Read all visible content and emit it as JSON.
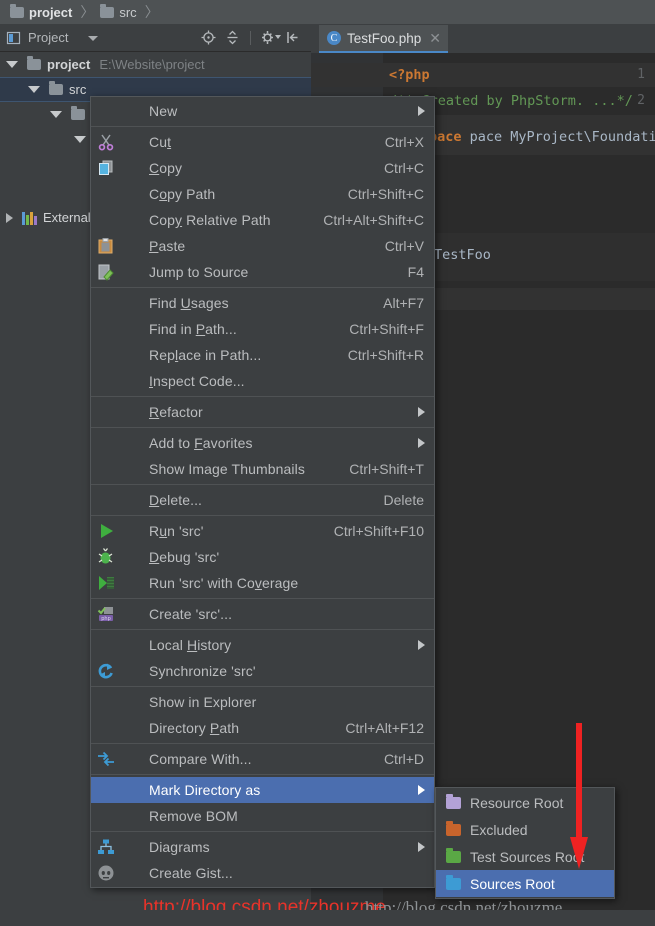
{
  "breadcrumb": {
    "items": [
      {
        "label": "project",
        "icon": "folder-icon",
        "bold": true
      },
      {
        "label": "src",
        "icon": "folder-icon",
        "bold": false
      }
    ],
    "separator": "〉"
  },
  "tool_window": {
    "title": "Project",
    "dropdown_icon": "chevron-down-icon",
    "window_icon": "project-view-icon",
    "actions": [
      {
        "name": "scroll-from-source-icon",
        "tip": "Select Opened File"
      },
      {
        "name": "collapse-all-icon",
        "tip": "Collapse All"
      },
      {
        "name": "gear-icon",
        "tip": "Settings"
      },
      {
        "name": "hide-icon",
        "tip": "Hide"
      }
    ]
  },
  "tree": {
    "rows": [
      {
        "name": "project",
        "path": "E:\\Website\\project",
        "expanded": true,
        "depth": 0,
        "icon": "folder-icon",
        "selected": false
      },
      {
        "name": "src",
        "path": "",
        "expanded": true,
        "depth": 1,
        "icon": "folder-icon",
        "selected": true
      },
      {
        "name": "",
        "path": "",
        "expanded": true,
        "depth": 2,
        "icon": "folder-icon",
        "selected": false
      },
      {
        "name": "",
        "path": "",
        "expanded": true,
        "depth": 3,
        "icon": "folder-icon",
        "selected": false
      },
      {
        "name": "External Libraries",
        "path": "",
        "expanded": false,
        "depth": 0,
        "icon": "libraries-icon",
        "selected": false
      }
    ]
  },
  "editor": {
    "tab": {
      "label": "TestFoo.php",
      "icon_letter": "C",
      "close_icon": "close-icon"
    },
    "lines": [
      {
        "number": "1",
        "text": "<?php",
        "kind": "keyword"
      },
      {
        "number": "2",
        "text": "/** Created by PhpStorm. ...*/",
        "kind": "comment"
      }
    ],
    "namespace_fragment": "pace MyProject\\Foundation",
    "namespace_keyword": "pace",
    "class_name_fragment": "TestFoo"
  },
  "context_menu": {
    "groups": [
      {
        "items": [
          {
            "label": "New",
            "mnemonic": "",
            "shortcut": "",
            "submenu": true,
            "icon": "",
            "highlighted": false
          }
        ]
      },
      {
        "items": [
          {
            "label": "Cut",
            "mnemonic": "t",
            "shortcut": "Ctrl+X",
            "submenu": false,
            "icon": "cut-icon",
            "highlighted": false
          },
          {
            "label": "Copy",
            "mnemonic": "C",
            "shortcut": "Ctrl+C",
            "submenu": false,
            "icon": "copy-icon",
            "highlighted": false
          },
          {
            "label": "Copy Path",
            "mnemonic": "o",
            "shortcut": "Ctrl+Shift+C",
            "submenu": false,
            "icon": "",
            "highlighted": false
          },
          {
            "label": "Copy Relative Path",
            "mnemonic": "y",
            "shortcut": "Ctrl+Alt+Shift+C",
            "submenu": false,
            "icon": "",
            "highlighted": false
          },
          {
            "label": "Paste",
            "mnemonic": "P",
            "shortcut": "Ctrl+V",
            "submenu": false,
            "icon": "paste-icon",
            "highlighted": false
          },
          {
            "label": "Jump to Source",
            "mnemonic": "",
            "shortcut": "F4",
            "submenu": false,
            "icon": "jump-to-source-icon",
            "highlighted": false
          }
        ]
      },
      {
        "items": [
          {
            "label": "Find Usages",
            "mnemonic": "U",
            "shortcut": "Alt+F7",
            "submenu": false,
            "icon": "",
            "highlighted": false
          },
          {
            "label": "Find in Path...",
            "mnemonic": "P",
            "shortcut": "Ctrl+Shift+F",
            "submenu": false,
            "icon": "",
            "highlighted": false
          },
          {
            "label": "Replace in Path...",
            "mnemonic": "l",
            "shortcut": "Ctrl+Shift+R",
            "submenu": false,
            "icon": "",
            "highlighted": false
          },
          {
            "label": "Inspect Code...",
            "mnemonic": "I",
            "shortcut": "",
            "submenu": false,
            "icon": "",
            "highlighted": false
          }
        ]
      },
      {
        "items": [
          {
            "label": "Refactor",
            "mnemonic": "R",
            "shortcut": "",
            "submenu": true,
            "icon": "",
            "highlighted": false
          }
        ]
      },
      {
        "items": [
          {
            "label": "Add to Favorites",
            "mnemonic": "F",
            "shortcut": "",
            "submenu": true,
            "icon": "",
            "highlighted": false
          },
          {
            "label": "Show Image Thumbnails",
            "mnemonic": "",
            "shortcut": "Ctrl+Shift+T",
            "submenu": false,
            "icon": "",
            "highlighted": false
          }
        ]
      },
      {
        "items": [
          {
            "label": "Delete...",
            "mnemonic": "D",
            "shortcut": "Delete",
            "submenu": false,
            "icon": "",
            "highlighted": false
          }
        ]
      },
      {
        "items": [
          {
            "label": "Run 'src'",
            "mnemonic": "u",
            "shortcut": "Ctrl+Shift+F10",
            "submenu": false,
            "icon": "run-icon",
            "highlighted": false
          },
          {
            "label": "Debug 'src'",
            "mnemonic": "D",
            "shortcut": "",
            "submenu": false,
            "icon": "debug-icon",
            "highlighted": false
          },
          {
            "label": "Run 'src' with Coverage",
            "mnemonic": "v",
            "shortcut": "",
            "submenu": false,
            "icon": "coverage-icon",
            "highlighted": false
          }
        ]
      },
      {
        "items": [
          {
            "label": "Create 'src'...",
            "mnemonic": "",
            "shortcut": "",
            "submenu": false,
            "icon": "php-create-icon",
            "highlighted": false
          }
        ]
      },
      {
        "items": [
          {
            "label": "Local History",
            "mnemonic": "H",
            "shortcut": "",
            "submenu": true,
            "icon": "",
            "highlighted": false
          },
          {
            "label": "Synchronize 'src'",
            "mnemonic": "",
            "shortcut": "",
            "submenu": false,
            "icon": "synchronize-icon",
            "highlighted": false
          }
        ]
      },
      {
        "items": [
          {
            "label": "Show in Explorer",
            "mnemonic": "",
            "shortcut": "",
            "submenu": false,
            "icon": "",
            "highlighted": false
          },
          {
            "label": "Directory Path",
            "mnemonic": "P",
            "shortcut": "Ctrl+Alt+F12",
            "submenu": false,
            "icon": "",
            "highlighted": false
          }
        ]
      },
      {
        "items": [
          {
            "label": "Compare With...",
            "mnemonic": "",
            "shortcut": "Ctrl+D",
            "submenu": false,
            "icon": "compare-icon",
            "highlighted": false
          }
        ]
      },
      {
        "items": [
          {
            "label": "Mark Directory as",
            "mnemonic": "",
            "shortcut": "",
            "submenu": true,
            "icon": "",
            "highlighted": true
          },
          {
            "label": "Remove BOM",
            "mnemonic": "",
            "shortcut": "",
            "submenu": false,
            "icon": "",
            "highlighted": false
          }
        ]
      },
      {
        "items": [
          {
            "label": "Diagrams",
            "mnemonic": "",
            "shortcut": "",
            "submenu": true,
            "icon": "diagrams-icon",
            "highlighted": false
          },
          {
            "label": "Create Gist...",
            "mnemonic": "",
            "shortcut": "",
            "submenu": false,
            "icon": "github-icon",
            "highlighted": false
          }
        ]
      }
    ]
  },
  "submenu": {
    "title": "Mark Directory as",
    "items": [
      {
        "label": "Resource Root",
        "color": "#b3a2d6",
        "icon": "folder-icon",
        "highlighted": false
      },
      {
        "label": "Excluded",
        "color": "#c8642c",
        "icon": "folder-icon",
        "highlighted": false
      },
      {
        "label": "Test Sources Root",
        "color": "#5aa845",
        "icon": "folder-icon",
        "highlighted": false
      },
      {
        "label": "Sources Root",
        "color": "#3d9bd4",
        "icon": "folder-icon",
        "highlighted": true
      }
    ]
  },
  "annotations": {
    "arrow_color": "#ee2222",
    "watermark_red": "http://blog.csdn.net/zhouzme",
    "watermark_grey": "http://blog.csdn.net/zhouzme"
  },
  "colors": {
    "background": "#3c3f41",
    "editor_background": "#2b2b2b",
    "menu_highlight": "#4b6eaf",
    "tree_selection": "#2f3a4a",
    "accent": "#4a88c7"
  }
}
